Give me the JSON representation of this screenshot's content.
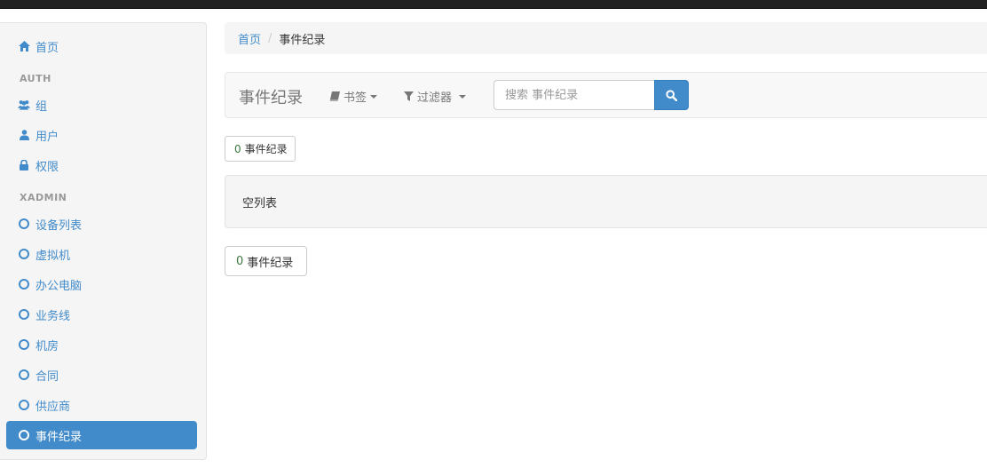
{
  "sidebar": {
    "home": {
      "label": "首页",
      "icon": "home-icon"
    },
    "auth_header": "AUTH",
    "auth_items": [
      {
        "label": "组",
        "icon": "users-icon"
      },
      {
        "label": "用户",
        "icon": "user-icon"
      },
      {
        "label": "权限",
        "icon": "lock-icon"
      }
    ],
    "xadmin_header": "XADMIN",
    "xadmin_items": [
      {
        "label": "设备列表",
        "icon": "circle-icon"
      },
      {
        "label": "虚拟机",
        "icon": "circle-icon"
      },
      {
        "label": "办公电脑",
        "icon": "circle-icon"
      },
      {
        "label": "业务线",
        "icon": "circle-icon"
      },
      {
        "label": "机房",
        "icon": "circle-icon"
      },
      {
        "label": "合同",
        "icon": "circle-icon"
      },
      {
        "label": "供应商",
        "icon": "circle-icon"
      },
      {
        "label": "事件纪录",
        "icon": "circle-icon",
        "active": true
      }
    ]
  },
  "breadcrumb": {
    "home": "首页",
    "separator": "/",
    "current": "事件纪录"
  },
  "toolbar": {
    "title": "事件纪录",
    "bookmarks_label": "书签",
    "filters_label": "过滤器",
    "search_placeholder": "搜索 事件纪录"
  },
  "result_count": {
    "count": "0",
    "label": "事件纪录"
  },
  "empty_text": "空列表",
  "colors": {
    "primary": "#428bca",
    "topbar": "#222222",
    "count_green": "#3c763d"
  }
}
